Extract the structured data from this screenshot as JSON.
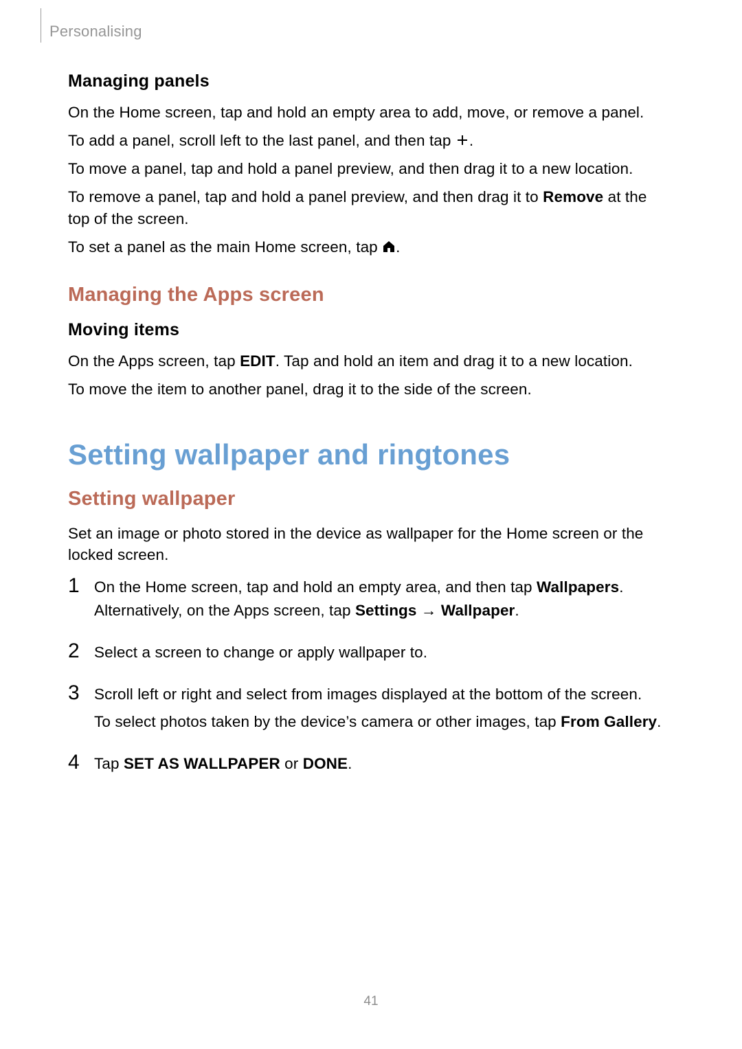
{
  "breadcrumb": "Personalising",
  "managing_panels": {
    "heading": "Managing panels",
    "p1": "On the Home screen, tap and hold an empty area to add, move, or remove a panel.",
    "p2_a": "To add a panel, scroll left to the last panel, and then tap ",
    "p2_b": ".",
    "p3": "To move a panel, tap and hold a panel preview, and then drag it to a new location.",
    "p4_a": "To remove a panel, tap and hold a panel preview, and then drag it to ",
    "p4_bold": "Remove",
    "p4_b": " at the top of the screen.",
    "p5_a": "To set a panel as the main Home screen, tap ",
    "p5_b": "."
  },
  "managing_apps": {
    "heading": "Managing the Apps screen",
    "moving_heading": "Moving items",
    "p1_a": "On the Apps screen, tap ",
    "p1_bold": "EDIT",
    "p1_b": ". Tap and hold an item and drag it to a new location.",
    "p2": "To move the item to another panel, drag it to the side of the screen."
  },
  "wallpaper_ringtones": {
    "main_heading": "Setting wallpaper and ringtones",
    "sub_heading": "Setting wallpaper",
    "intro": "Set an image or photo stored in the device as wallpaper for the Home screen or the locked screen.",
    "steps": {
      "n1": "1",
      "s1_a": "On the Home screen, tap and hold an empty area, and then tap ",
      "s1_bold1": "Wallpapers",
      "s1_b": ". Alternatively, on the Apps screen, tap ",
      "s1_bold2": "Settings",
      "s1_arrow": " → ",
      "s1_bold3": "Wallpaper",
      "s1_c": ".",
      "n2": "2",
      "s2": "Select a screen to change or apply wallpaper to.",
      "n3": "3",
      "s3a": "Scroll left or right and select from images displayed at the bottom of the screen.",
      "s3b_a": "To select photos taken by the device’s camera or other images, tap ",
      "s3b_bold": "From Gallery",
      "s3b_b": ".",
      "n4": "4",
      "s4_a": "Tap ",
      "s4_bold1": "SET AS WALLPAPER",
      "s4_mid": " or ",
      "s4_bold2": "DONE",
      "s4_b": "."
    }
  },
  "page_number": "41"
}
